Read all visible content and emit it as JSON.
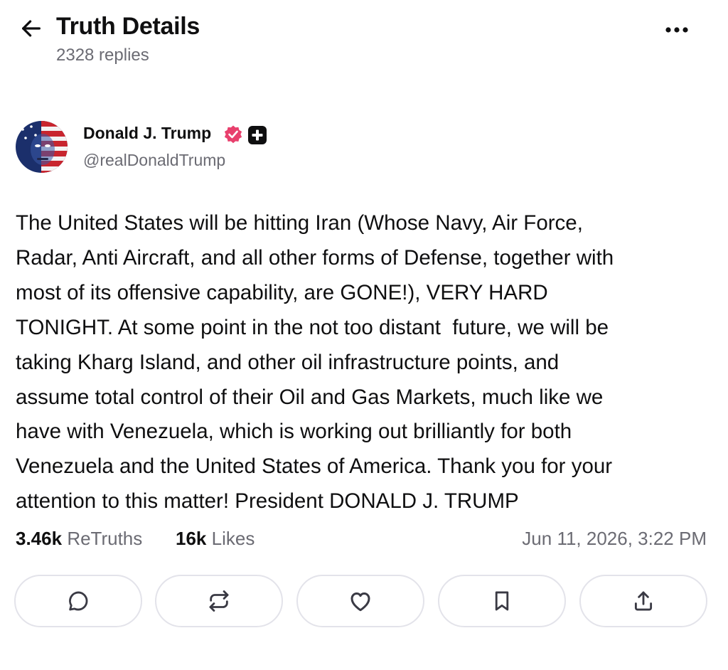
{
  "header": {
    "title": "Truth Details",
    "replies_count": "2328 replies"
  },
  "author": {
    "name": "Donald J. Trump",
    "handle": "@realDonaldTrump",
    "verified": true,
    "badge_color": "#e8406d"
  },
  "post": {
    "text": "The United States will be hitting Iran (Whose Navy, Air Force,\nRadar, Anti Aircraft, and all other forms of Defense, together with\nmost of its offensive capability, are GONE!), VERY HARD\nTONIGHT. At some point in the not too distant  future, we will be\ntaking Kharg Island, and other oil infrastructure points, and\nassume total control of their Oil and Gas Markets, much like we\nhave with Venezuela, which is working out brilliantly for both\nVenezuela and the United States of America. Thank you for your\nattention to this matter! President DONALD J. TRUMP"
  },
  "stats": {
    "retruths_count": "3.46k",
    "retruths_label": "ReTruths",
    "likes_count": "16k",
    "likes_label": "Likes",
    "timestamp": "Jun 11, 2026, 3:22 PM"
  },
  "actions": [
    {
      "name": "reply",
      "icon": "reply-icon"
    },
    {
      "name": "retruth",
      "icon": "retruth-icon"
    },
    {
      "name": "like",
      "icon": "heart-icon"
    },
    {
      "name": "bookmark",
      "icon": "bookmark-icon"
    },
    {
      "name": "share",
      "icon": "share-icon"
    }
  ],
  "icons": {
    "back": "arrow-left-icon",
    "more": "more-horizontal-icon"
  }
}
